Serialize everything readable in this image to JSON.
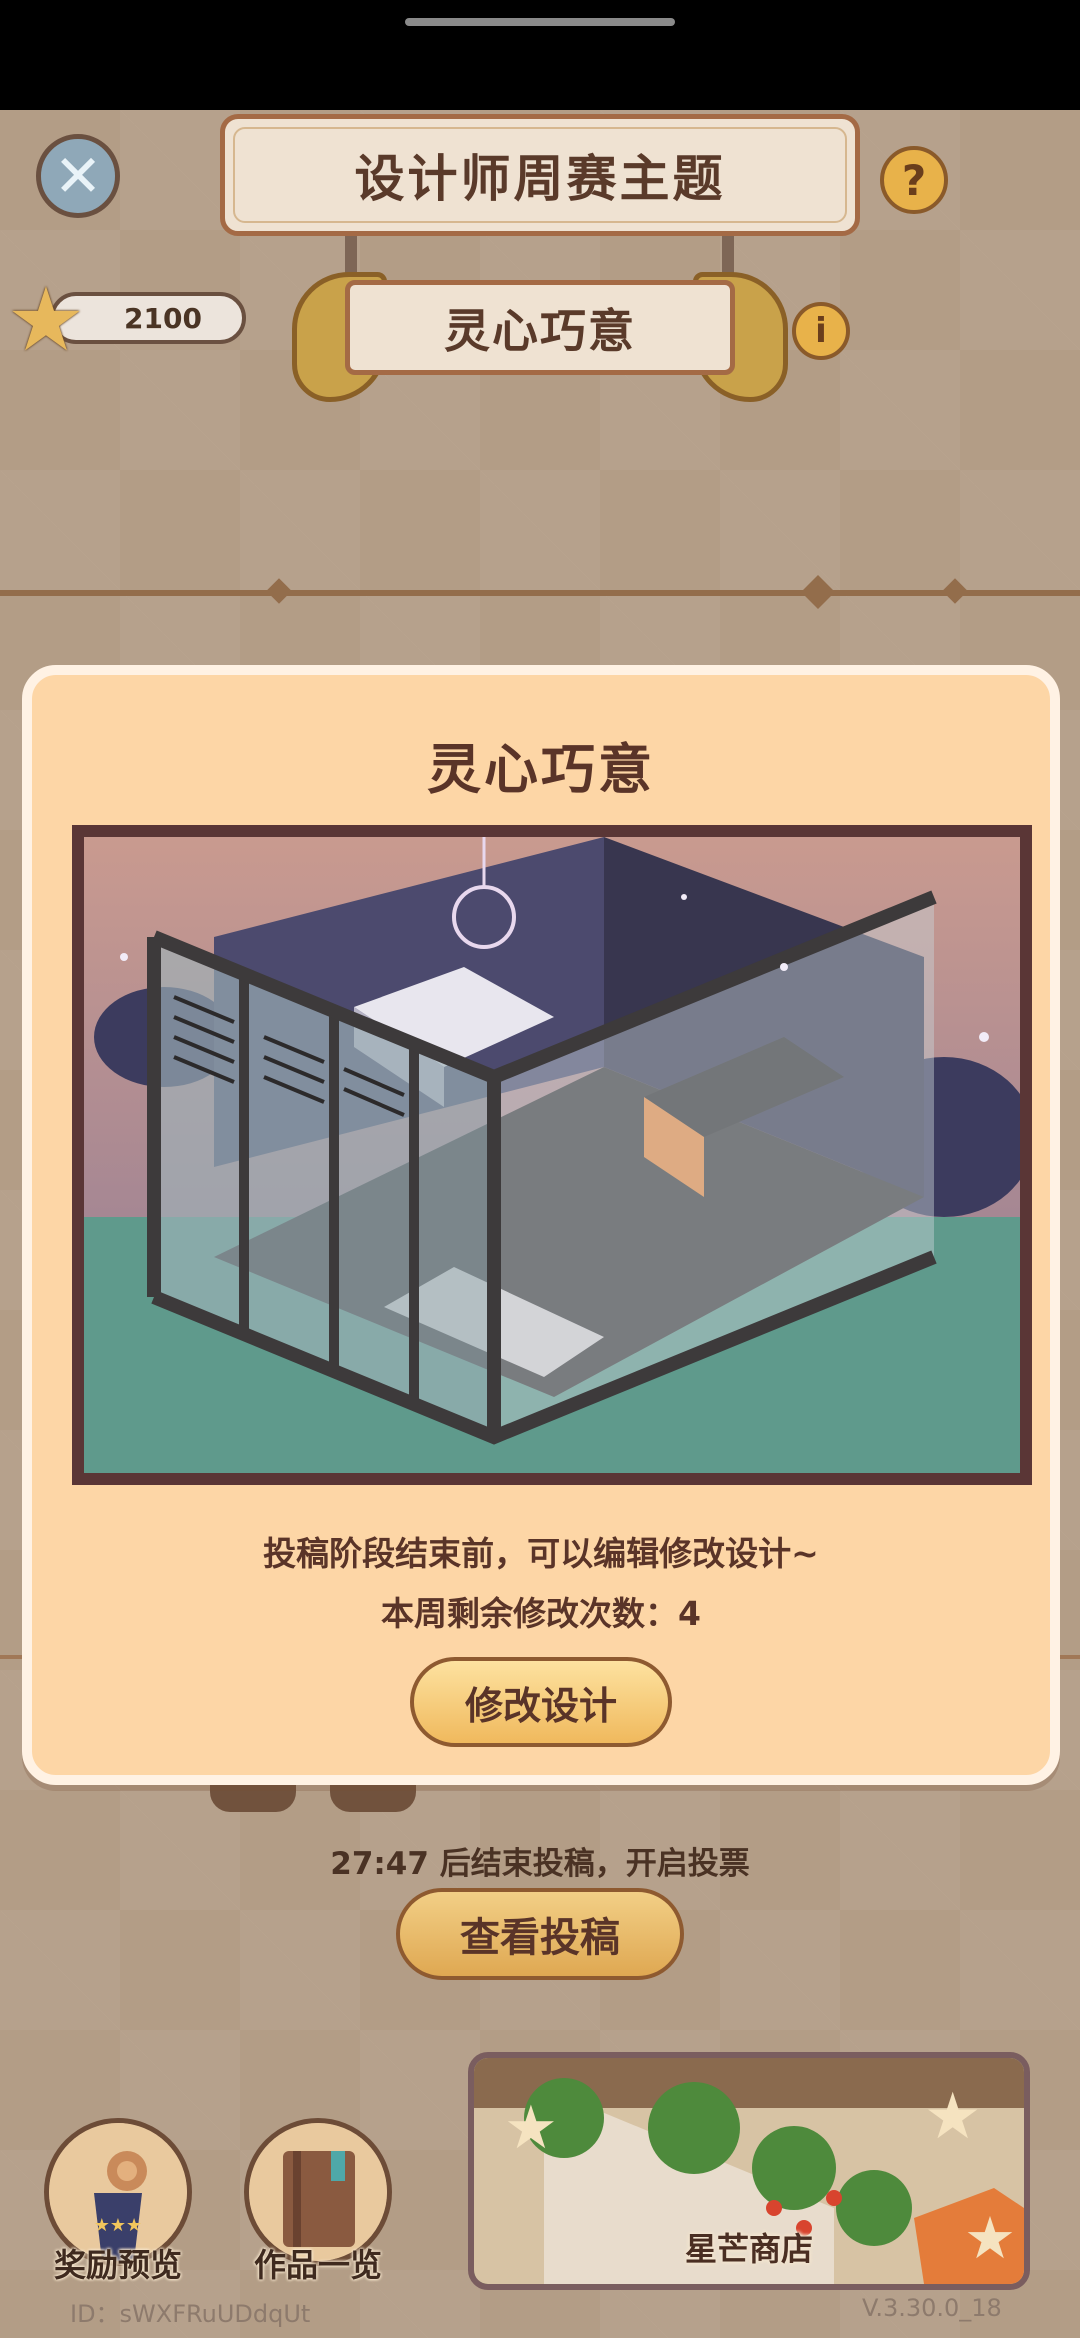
{
  "header": {
    "title": "设计师周赛主题",
    "theme_name": "灵心巧意",
    "close_icon": "✕",
    "help_icon": "?",
    "info_icon": "i"
  },
  "currency": {
    "icon": "★",
    "value": "2100"
  },
  "modal": {
    "title": "灵心巧意",
    "message_line1": "投稿阶段结束前，可以编辑修改设计~",
    "message_line2": "本周剩余修改次数：4",
    "edit_button": "修改设计"
  },
  "contest": {
    "countdown": "27:47 后结束投稿，开启投票",
    "view_button": "查看投稿"
  },
  "bottom_nav": {
    "rewards_label": "奖励预览",
    "works_label": "作品一览",
    "shop_label": "星芒商店"
  },
  "footer": {
    "user_id": "ID：sWXFRuUDdqUt",
    "version": "V.3.30.0_18"
  },
  "colors": {
    "modal_bg": "#fdd6a6",
    "text_brown": "#5a3428",
    "button_gold": "#f0b95d"
  }
}
